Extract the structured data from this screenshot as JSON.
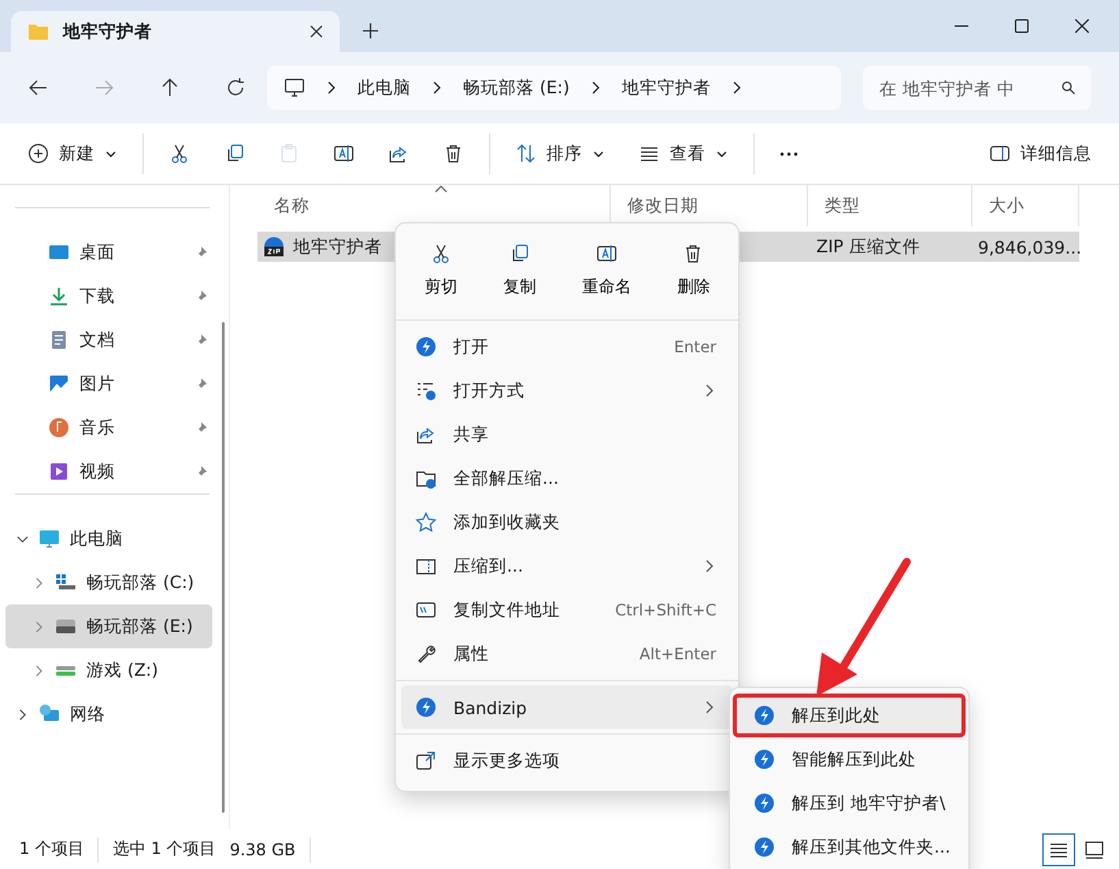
{
  "tab": {
    "title": "地牢守护者"
  },
  "address": {
    "segments": [
      "此电脑",
      "畅玩部落 (E:)",
      "地牢守护者"
    ]
  },
  "search": {
    "placeholder": "在 地牢守护者 中"
  },
  "toolbar": [
    {
      "kind": "new",
      "label": "新建",
      "dropdown": true,
      "disabled": false
    },
    {
      "kind": "separator"
    },
    {
      "kind": "cut",
      "dropdown": false,
      "disabled": false
    },
    {
      "kind": "copy",
      "dropdown": false,
      "disabled": false
    },
    {
      "kind": "paste",
      "dropdown": false,
      "disabled": true
    },
    {
      "kind": "rename",
      "dropdown": false,
      "disabled": false
    },
    {
      "kind": "share",
      "dropdown": false,
      "disabled": false
    },
    {
      "kind": "delete",
      "dropdown": false,
      "disabled": false
    },
    {
      "kind": "separator"
    },
    {
      "kind": "sort",
      "label": "排序",
      "dropdown": true,
      "disabled": false
    },
    {
      "kind": "view",
      "label": "查看",
      "dropdown": true,
      "disabled": false
    },
    {
      "kind": "separator"
    },
    {
      "kind": "more",
      "dropdown": false,
      "disabled": false
    },
    {
      "kind": "details",
      "label": "详细信息",
      "dropdown": false,
      "disabled": false
    }
  ],
  "sidebar": {
    "quick_access": [
      {
        "kind": "desktop",
        "label": "桌面",
        "pinned": true
      },
      {
        "kind": "downloads",
        "label": "下载",
        "pinned": true
      },
      {
        "kind": "documents",
        "label": "文档",
        "pinned": true
      },
      {
        "kind": "pictures",
        "label": "图片",
        "pinned": true
      },
      {
        "kind": "music",
        "label": "音乐",
        "pinned": true
      },
      {
        "kind": "videos",
        "label": "视频",
        "pinned": true
      }
    ],
    "tree": [
      {
        "kind": "pc",
        "label": "此电脑",
        "expanded": true,
        "selected": false,
        "children": [
          {
            "kind": "drive_system",
            "label": "畅玩部落 (C:)",
            "expanded": false,
            "selected": false
          },
          {
            "kind": "drive",
            "label": "畅玩部落 (E:)",
            "expanded": false,
            "selected": true
          },
          {
            "kind": "drive_green",
            "label": "游戏 (Z:)",
            "expanded": false,
            "selected": false
          }
        ]
      },
      {
        "kind": "network",
        "label": "网络",
        "expanded": false,
        "selected": false
      }
    ]
  },
  "file_list": {
    "columns": [
      {
        "label": "名称",
        "sorted": true
      },
      {
        "label": "修改日期",
        "sorted": false
      },
      {
        "label": "类型",
        "sorted": false
      },
      {
        "label": "大小",
        "sorted": false
      }
    ],
    "rows": [
      {
        "name": "地牢守护者",
        "type": "ZIP 压缩文件",
        "size": "9,846,039...",
        "selected": true
      }
    ]
  },
  "context_menu": {
    "quick_actions": [
      {
        "kind": "cut",
        "label": "剪切"
      },
      {
        "kind": "copy",
        "label": "复制"
      },
      {
        "kind": "rename",
        "label": "重命名"
      },
      {
        "kind": "delete",
        "label": "删除"
      }
    ],
    "items": [
      {
        "kind": "open",
        "label": "打开",
        "shortcut": "Enter",
        "submenu": false,
        "highlighted": false
      },
      {
        "kind": "open_with",
        "label": "打开方式",
        "submenu": true,
        "highlighted": false
      },
      {
        "kind": "share",
        "label": "共享",
        "submenu": false,
        "highlighted": false
      },
      {
        "kind": "extract_all",
        "label": "全部解压缩...",
        "submenu": false,
        "highlighted": false
      },
      {
        "kind": "favorite",
        "label": "添加到收藏夹",
        "submenu": false,
        "highlighted": false
      },
      {
        "kind": "compress",
        "label": "压缩到...",
        "submenu": true,
        "highlighted": false
      },
      {
        "kind": "copy_path",
        "label": "复制文件地址",
        "shortcut": "Ctrl+Shift+C",
        "submenu": false,
        "highlighted": false
      },
      {
        "kind": "properties",
        "label": "属性",
        "shortcut": "Alt+Enter",
        "submenu": false,
        "highlighted": false
      },
      {
        "kind": "separator"
      },
      {
        "kind": "open",
        "label": "Bandizip",
        "submenu": true,
        "highlighted": true
      },
      {
        "kind": "separator"
      },
      {
        "kind": "more_options",
        "label": "显示更多选项",
        "submenu": false,
        "highlighted": false
      }
    ]
  },
  "submenu": {
    "items": [
      {
        "label": "解压到此处",
        "highlighted": true
      },
      {
        "label": "智能解压到此处",
        "highlighted": false
      },
      {
        "label": "解压到 地牢守护者\\",
        "highlighted": false
      },
      {
        "label": "解压到其他文件夹...",
        "highlighted": false
      }
    ]
  },
  "status_bar": {
    "item_count": "1 个项目",
    "selection": "选中 1 个项目",
    "size": "9.38 GB",
    "views": [
      {
        "kind": "details",
        "selected": true
      },
      {
        "kind": "tiles",
        "selected": false
      }
    ]
  }
}
